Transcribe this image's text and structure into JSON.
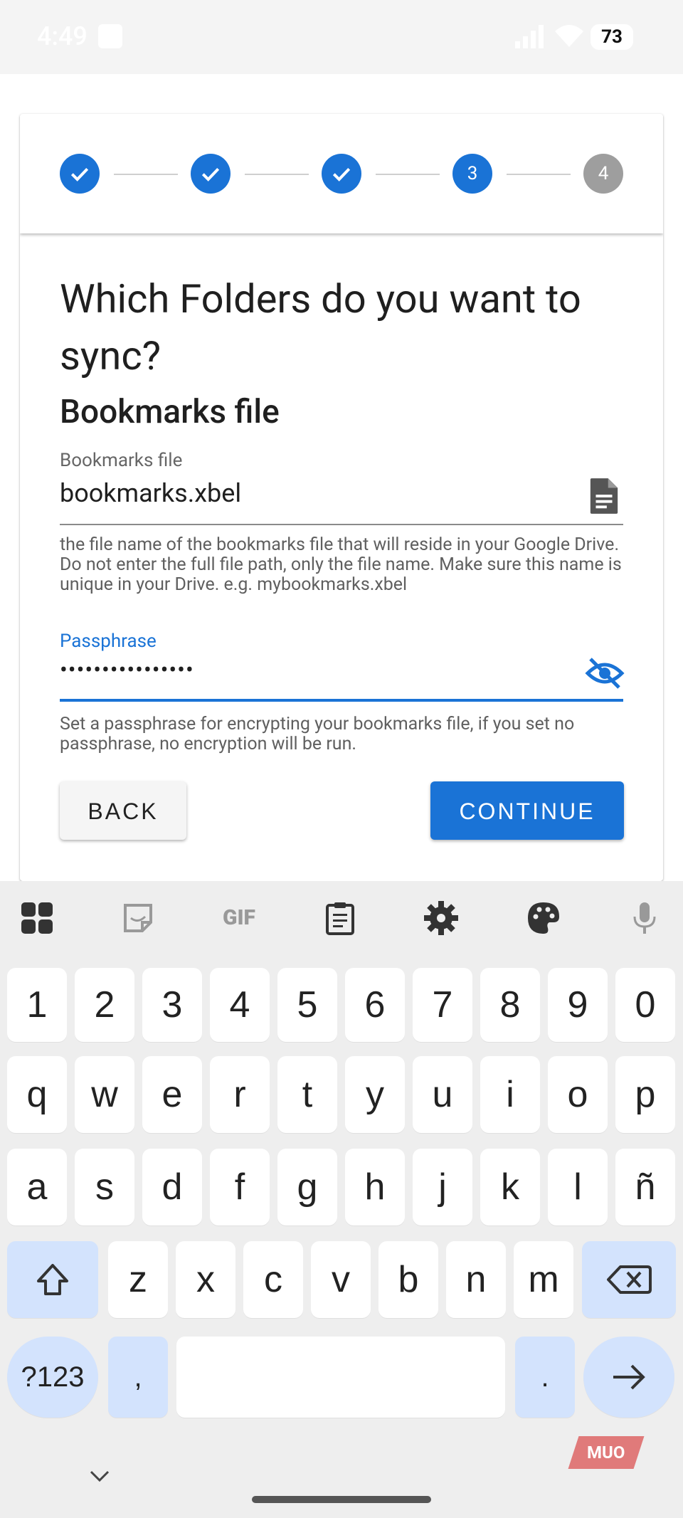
{
  "status_bar": {
    "time": "4:49",
    "battery": "73"
  },
  "stepper": {
    "steps": [
      {
        "state": "done",
        "label": ""
      },
      {
        "state": "done",
        "label": ""
      },
      {
        "state": "done",
        "label": ""
      },
      {
        "state": "active",
        "label": "3"
      },
      {
        "state": "pending",
        "label": "4"
      }
    ]
  },
  "form": {
    "title": "Which Folders do you want to sync?",
    "section_title": "Bookmarks file",
    "bookmarks_field": {
      "label": "Bookmarks file",
      "value": "bookmarks.xbel",
      "help": "the file name of the bookmarks file that will reside in your Google Drive. Do not enter the full file path, only the file name. Make sure this name is unique in your Drive. e.g. mybookmarks.xbel"
    },
    "passphrase_field": {
      "label": "Passphrase",
      "value": "••••••••••••••••",
      "help": "Set a passphrase for encrypting your bookmarks file, if you set no passphrase, no encryption will be run."
    },
    "back_label": "BACK",
    "continue_label": "CONTINUE"
  },
  "keyboard": {
    "toolbar_icons": [
      "apps-grid-icon",
      "sticker-icon",
      "gif-icon",
      "clipboard-icon",
      "settings-icon",
      "palette-icon",
      "microphone-icon"
    ],
    "gif_label": "GIF",
    "row_numbers": [
      "1",
      "2",
      "3",
      "4",
      "5",
      "6",
      "7",
      "8",
      "9",
      "0"
    ],
    "row_1": [
      "q",
      "w",
      "e",
      "r",
      "t",
      "y",
      "u",
      "i",
      "o",
      "p"
    ],
    "row_2": [
      "a",
      "s",
      "d",
      "f",
      "g",
      "h",
      "j",
      "k",
      "l",
      "ñ"
    ],
    "row_3": [
      "z",
      "x",
      "c",
      "v",
      "b",
      "n",
      "m"
    ],
    "symbols_label": "?123",
    "comma_label": ",",
    "period_label": "."
  },
  "watermark": "MUO",
  "colors": {
    "accent": "#1a73d6",
    "pending_step": "#9e9e9e",
    "keyboard_special": "#d3e3fd"
  }
}
